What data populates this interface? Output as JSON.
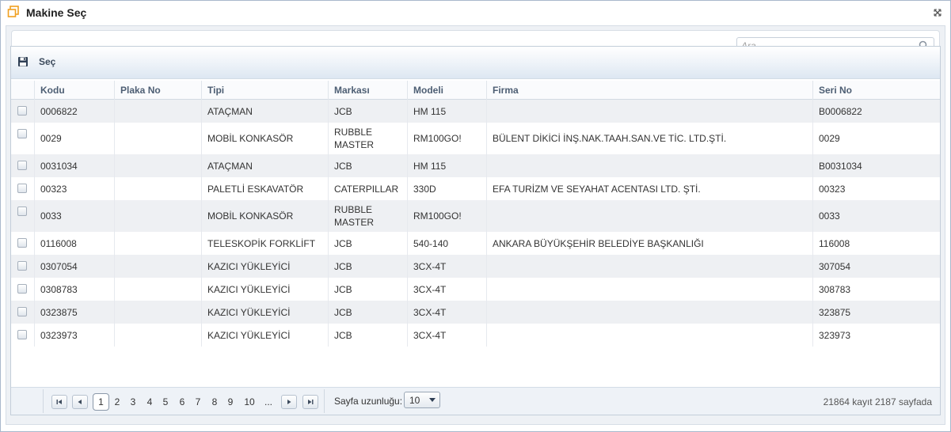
{
  "dialog": {
    "title": "Makine Seç"
  },
  "search": {
    "placeholder": "Ara",
    "value": ""
  },
  "toolbar": {
    "select_label": "Seç"
  },
  "columns": [
    "Kodu",
    "Plaka No",
    "Tipi",
    "Markası",
    "Modeli",
    "Firma",
    "Seri No"
  ],
  "rows": [
    {
      "kodu": "0006822",
      "plaka": "",
      "tipi": "ATAÇMAN",
      "marka": "JCB",
      "model": "HM 115",
      "firma": "",
      "seri": "B0006822"
    },
    {
      "kodu": "0029",
      "plaka": "",
      "tipi": "MOBİL KONKASÖR",
      "marka": "RUBBLE MASTER",
      "model": "RM100GO!",
      "firma": "BÜLENT DİKİCİ İNŞ.NAK.TAAH.SAN.VE TİC. LTD.ŞTİ.",
      "seri": "0029"
    },
    {
      "kodu": "0031034",
      "plaka": "",
      "tipi": "ATAÇMAN",
      "marka": "JCB",
      "model": "HM 115",
      "firma": "",
      "seri": "B0031034"
    },
    {
      "kodu": "00323",
      "plaka": "",
      "tipi": "PALETLİ ESKAVATÖR",
      "marka": "CATERPILLAR",
      "model": "330D",
      "firma": "EFA TURİZM VE SEYAHAT ACENTASI LTD. ŞTİ.",
      "seri": "00323"
    },
    {
      "kodu": "0033",
      "plaka": "",
      "tipi": "MOBİL KONKASÖR",
      "marka": "RUBBLE MASTER",
      "model": "RM100GO!",
      "firma": "",
      "seri": "0033"
    },
    {
      "kodu": "0116008",
      "plaka": "",
      "tipi": "TELESKOPİK FORKLİFT",
      "marka": "JCB",
      "model": "540-140",
      "firma": "ANKARA BÜYÜKŞEHİR BELEDİYE BAŞKANLIĞI",
      "seri": "116008"
    },
    {
      "kodu": "0307054",
      "plaka": "",
      "tipi": "KAZICI YÜKLEYİCİ",
      "marka": "JCB",
      "model": "3CX-4T",
      "firma": "",
      "seri": "307054"
    },
    {
      "kodu": "0308783",
      "plaka": "",
      "tipi": "KAZICI YÜKLEYİCİ",
      "marka": "JCB",
      "model": "3CX-4T",
      "firma": "",
      "seri": "308783"
    },
    {
      "kodu": "0323875",
      "plaka": "",
      "tipi": "KAZICI YÜKLEYİCİ",
      "marka": "JCB",
      "model": "3CX-4T",
      "firma": "",
      "seri": "323875"
    },
    {
      "kodu": "0323973",
      "plaka": "",
      "tipi": "KAZICI YÜKLEYİCİ",
      "marka": "JCB",
      "model": "3CX-4T",
      "firma": "",
      "seri": "323973"
    }
  ],
  "pager": {
    "pages": [
      "1",
      "2",
      "3",
      "4",
      "5",
      "6",
      "7",
      "8",
      "9",
      "10",
      "..."
    ],
    "current_page": "1",
    "page_size_label": "Sayfa uzunluğu:",
    "page_size": "10",
    "info": "21864 kayıt 2187 sayfada"
  },
  "icons": {
    "window": "window-restore-icon",
    "close": "close-icon",
    "search": "search-icon",
    "save": "floppy-disk-icon",
    "pager": [
      "first-page-icon",
      "prev-page-icon",
      "next-page-icon",
      "last-page-icon"
    ]
  },
  "colors": {
    "accent": "#f0a020",
    "header_text": "#4d5e73",
    "row_alt": "#eef0f3"
  }
}
